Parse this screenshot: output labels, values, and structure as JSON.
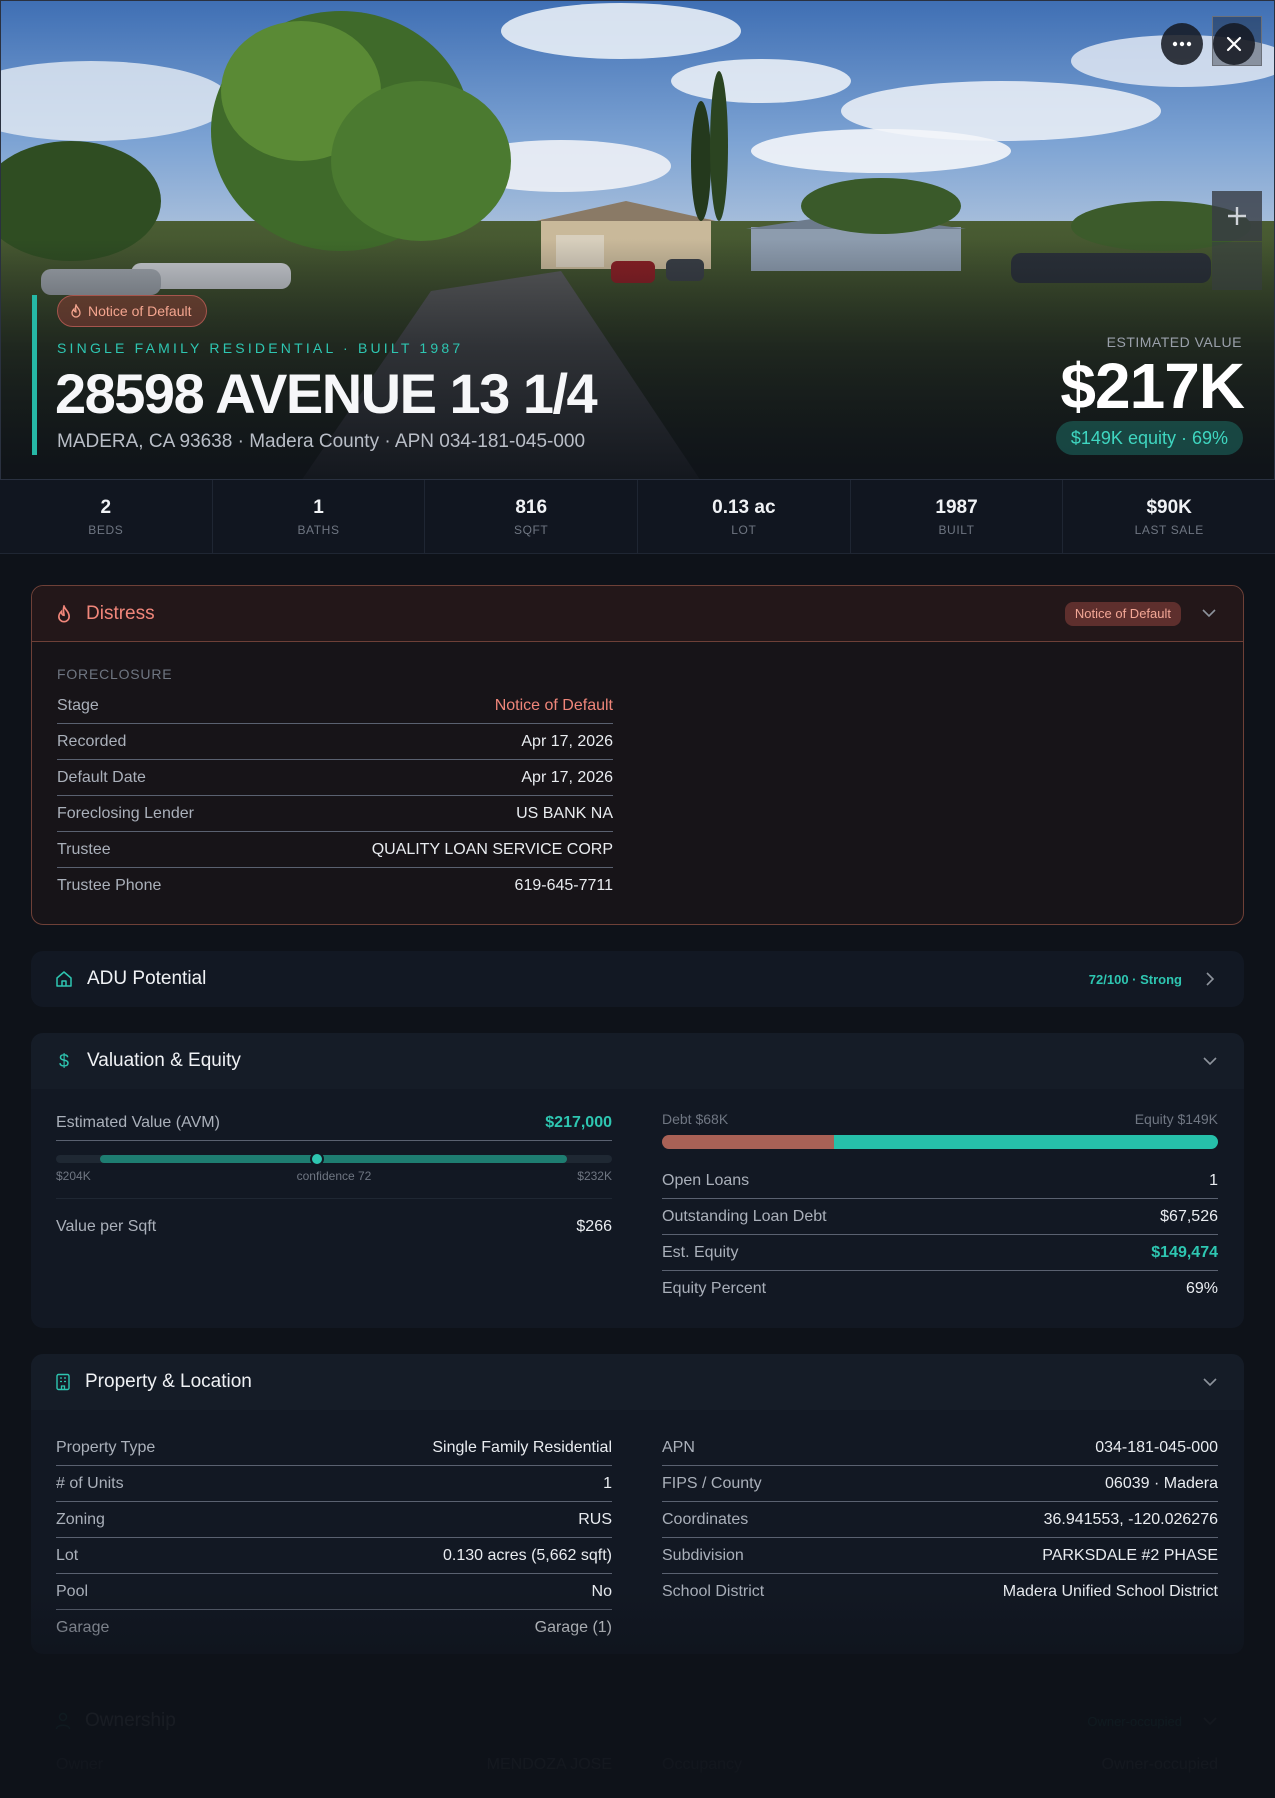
{
  "hero": {
    "distress_pill": "Notice of Default",
    "subtitle": "SINGLE FAMILY RESIDENTIAL · BUILT 1987",
    "address": "28598 AVENUE 13 1/4",
    "location": "MADERA, CA 93638 · Madera County · APN 034-181-045-000",
    "estimated_label": "ESTIMATED VALUE",
    "estimated_value": "$217K",
    "equity_pill": "$149K equity · 69%",
    "icons": [
      "more-horizontal-icon",
      "close-icon",
      "plus-icon",
      "flame-icon"
    ]
  },
  "stats": [
    {
      "value": "2",
      "label": "BEDS"
    },
    {
      "value": "1",
      "label": "BATHS"
    },
    {
      "value": "816",
      "label": "SQFT"
    },
    {
      "value": "0.13 ac",
      "label": "LOT"
    },
    {
      "value": "1987",
      "label": "BUILT"
    },
    {
      "value": "$90K",
      "label": "LAST SALE"
    }
  ],
  "distress": {
    "title": "Distress",
    "badge": "Notice of Default",
    "section": "FORECLOSURE",
    "rows": [
      {
        "k": "Stage",
        "v": "Notice of Default"
      },
      {
        "k": "Recorded",
        "v": "Apr 17, 2026"
      },
      {
        "k": "Default Date",
        "v": "Apr 17, 2026"
      },
      {
        "k": "Foreclosing Lender",
        "v": "US BANK NA"
      },
      {
        "k": "Trustee",
        "v": "QUALITY LOAN SERVICE CORP"
      },
      {
        "k": "Trustee Phone",
        "v": "619-645-7711"
      }
    ]
  },
  "adu": {
    "title": "ADU Potential",
    "score": "72/100 · Strong"
  },
  "valuation": {
    "title": "Valuation & Equity",
    "avm_label": "Estimated Value (AVM)",
    "avm_value": "$217,000",
    "range_low": "$204K",
    "range_mid": "confidence 72",
    "range_high": "$232K",
    "range": {
      "min": 204000,
      "max": 232000,
      "value": 217000
    },
    "per_sqft_label": "Value per Sqft",
    "per_sqft_value": "$266",
    "debt_label": "Debt $68K",
    "equity_label": "Equity $149K",
    "debt_fraction": 0.31,
    "rows": [
      {
        "k": "Open Loans",
        "v": "1"
      },
      {
        "k": "Outstanding Loan Debt",
        "v": "$67,526"
      },
      {
        "k": "Est. Equity",
        "v": "$149,474"
      },
      {
        "k": "Equity Percent",
        "v": "69%"
      }
    ]
  },
  "property": {
    "title": "Property & Location",
    "left": [
      {
        "k": "Property Type",
        "v": "Single Family Residential"
      },
      {
        "k": "# of Units",
        "v": "1"
      },
      {
        "k": "Zoning",
        "v": "RUS"
      },
      {
        "k": "Lot",
        "v": "0.130 acres (5,662 sqft)"
      },
      {
        "k": "Pool",
        "v": "No"
      },
      {
        "k": "Garage",
        "v": "Garage (1)"
      }
    ],
    "right": [
      {
        "k": "APN",
        "v": "034-181-045-000"
      },
      {
        "k": "FIPS / County",
        "v": "06039 · Madera"
      },
      {
        "k": "Coordinates",
        "v": "36.941553, -120.026276"
      },
      {
        "k": "Subdivision",
        "v": "PARKSDALE #2 PHASE"
      },
      {
        "k": "School District",
        "v": "Madera Unified School District"
      }
    ]
  },
  "ownership": {
    "title": "Ownership",
    "badge": "Owner-occupied",
    "owner_label": "Owner",
    "owner_value": "MENDOZA JOSE",
    "occupancy_label": "Occupancy",
    "occupancy_value": "Owner-occupied"
  },
  "colors": {
    "accent": "#26b8a6",
    "distress": "#f0867a",
    "background": "#0e1219"
  }
}
